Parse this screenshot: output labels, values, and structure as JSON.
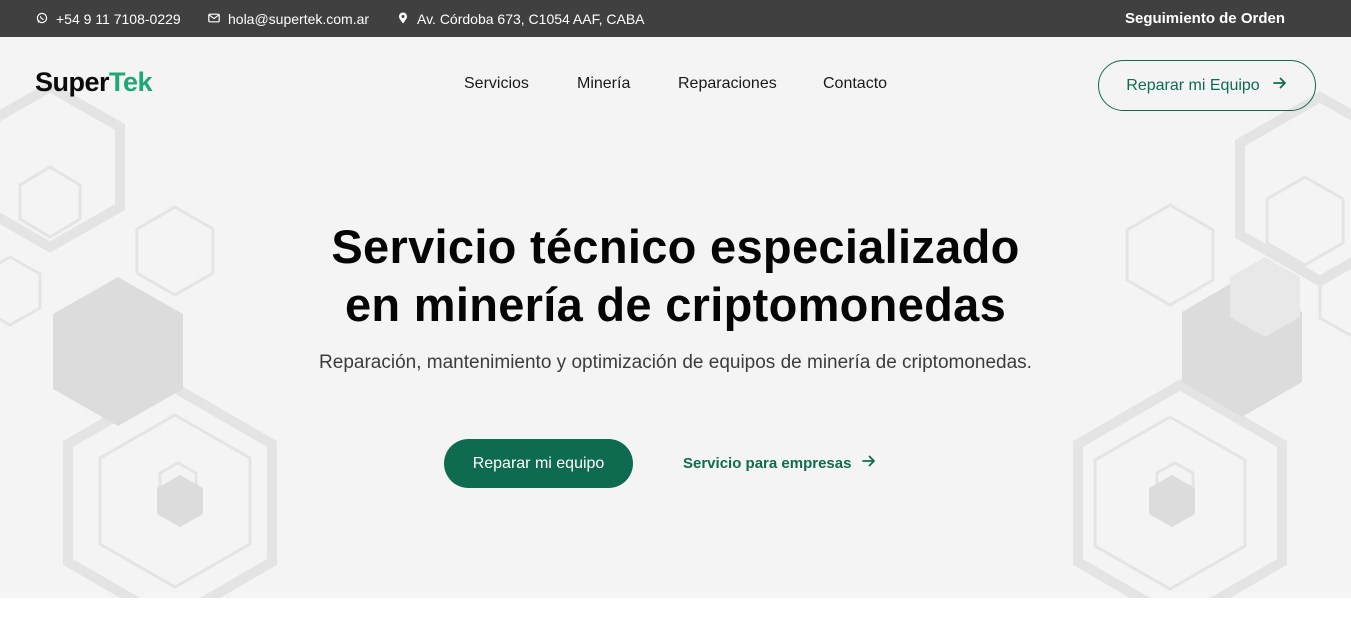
{
  "topbar": {
    "phone": "+54 9 11 7108-0229",
    "email": "hola@supertek.com.ar",
    "address": "Av. Córdoba 673, C1054 AAF, CABA",
    "tracking": "Seguimiento de Orden"
  },
  "header": {
    "logo_super": "Super",
    "logo_tek": "Tek",
    "nav": [
      "Servicios",
      "Minería",
      "Reparaciones",
      "Contacto"
    ],
    "cta": "Reparar mi Equipo"
  },
  "hero": {
    "title_line1": "Servicio técnico especializado",
    "title_line2": "en minería de criptomonedas",
    "subtitle": "Reparación, mantenimiento y optimización de equipos de minería de criptomonedas.",
    "primary_cta": "Reparar mi equipo",
    "secondary_cta": "Servicio para empresas"
  },
  "icons": {
    "phone": "whatsapp-icon",
    "email": "envelope-icon",
    "address": "map-pin-icon",
    "arrow": "arrow-right-icon",
    "background": "hexagon-pattern"
  },
  "colors": {
    "topbar_bg": "#404040",
    "brand_green": "#0f6b4f",
    "logo_accent": "#1fa774",
    "hero_bg": "#f4f4f4"
  }
}
